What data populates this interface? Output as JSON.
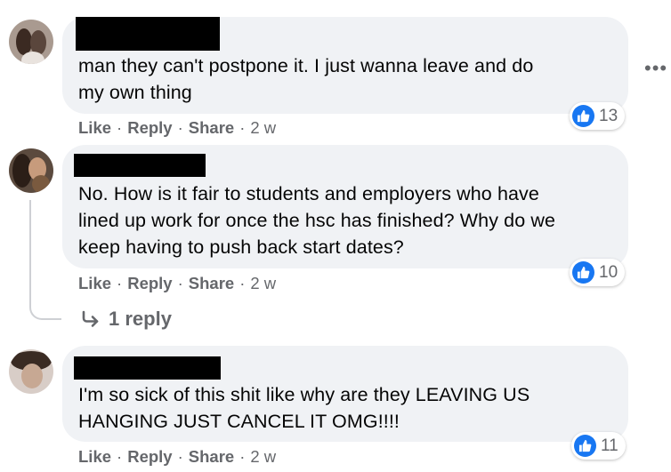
{
  "comments": [
    {
      "text_lines": [
        "man they can't postpone it. I just wanna leave and do",
        "my own thing"
      ],
      "actions": {
        "like": "Like",
        "reply": "Reply",
        "share": "Share",
        "time": "2 w"
      },
      "reaction_count": "13"
    },
    {
      "text_lines": [
        "No. How is it fair to students and employers who have",
        "lined up work for once the hsc has finished? Why do we",
        "keep having to push back start dates?"
      ],
      "actions": {
        "like": "Like",
        "reply": "Reply",
        "share": "Share",
        "time": "2 w"
      },
      "reaction_count": "10"
    },
    {
      "text_lines": [
        "I'm so sick of this shit like why are they LEAVING US",
        "HANGING JUST CANCEL IT OMG!!!!"
      ],
      "actions": {
        "like": "Like",
        "reply": "Reply",
        "share": "Share",
        "time": "2 w"
      },
      "reaction_count": "11"
    }
  ],
  "replies_link": "1 reply",
  "more_icon": "more-options-icon",
  "colors": {
    "bubble": "#f0f2f5",
    "like_blue": "#1877f2",
    "meta_gray": "#65676b",
    "redaction": "#000000"
  }
}
